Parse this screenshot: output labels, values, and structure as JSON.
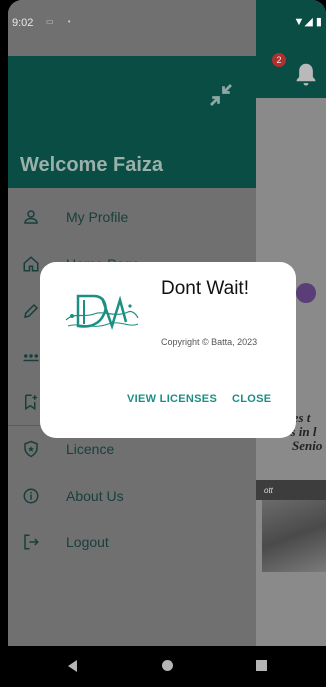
{
  "status_bar": {
    "time": "9:02",
    "left_icons": "▭ •",
    "right_icons": "▼◢ ▮"
  },
  "background_app": {
    "notification_count": "2",
    "text_lines": [
      "ries t",
      "os in l",
      "Senio"
    ],
    "strip_text": "ott"
  },
  "drawer": {
    "welcome": "Welcome Faiza",
    "items": [
      {
        "label": "My Profile",
        "icon": "person-icon"
      },
      {
        "label": "Home Page",
        "icon": "home-icon"
      },
      {
        "label": "",
        "icon": "pencil-icon"
      },
      {
        "label": "",
        "icon": "password-icon"
      },
      {
        "label": "",
        "icon": "bookmark-add-icon"
      },
      {
        "label": "Licence",
        "icon": "shield-star-icon"
      },
      {
        "label": "About Us",
        "icon": "info-icon"
      },
      {
        "label": "Logout",
        "icon": "logout-icon"
      }
    ]
  },
  "dialog": {
    "title": "Dont Wait!",
    "copyright": "Copyright © Batta, 2023",
    "view_licenses": "VIEW LICENSES",
    "close": "CLOSE"
  },
  "colors": {
    "header": "#0a4d44",
    "accent": "#1c8f82",
    "scrim": "#707070"
  }
}
